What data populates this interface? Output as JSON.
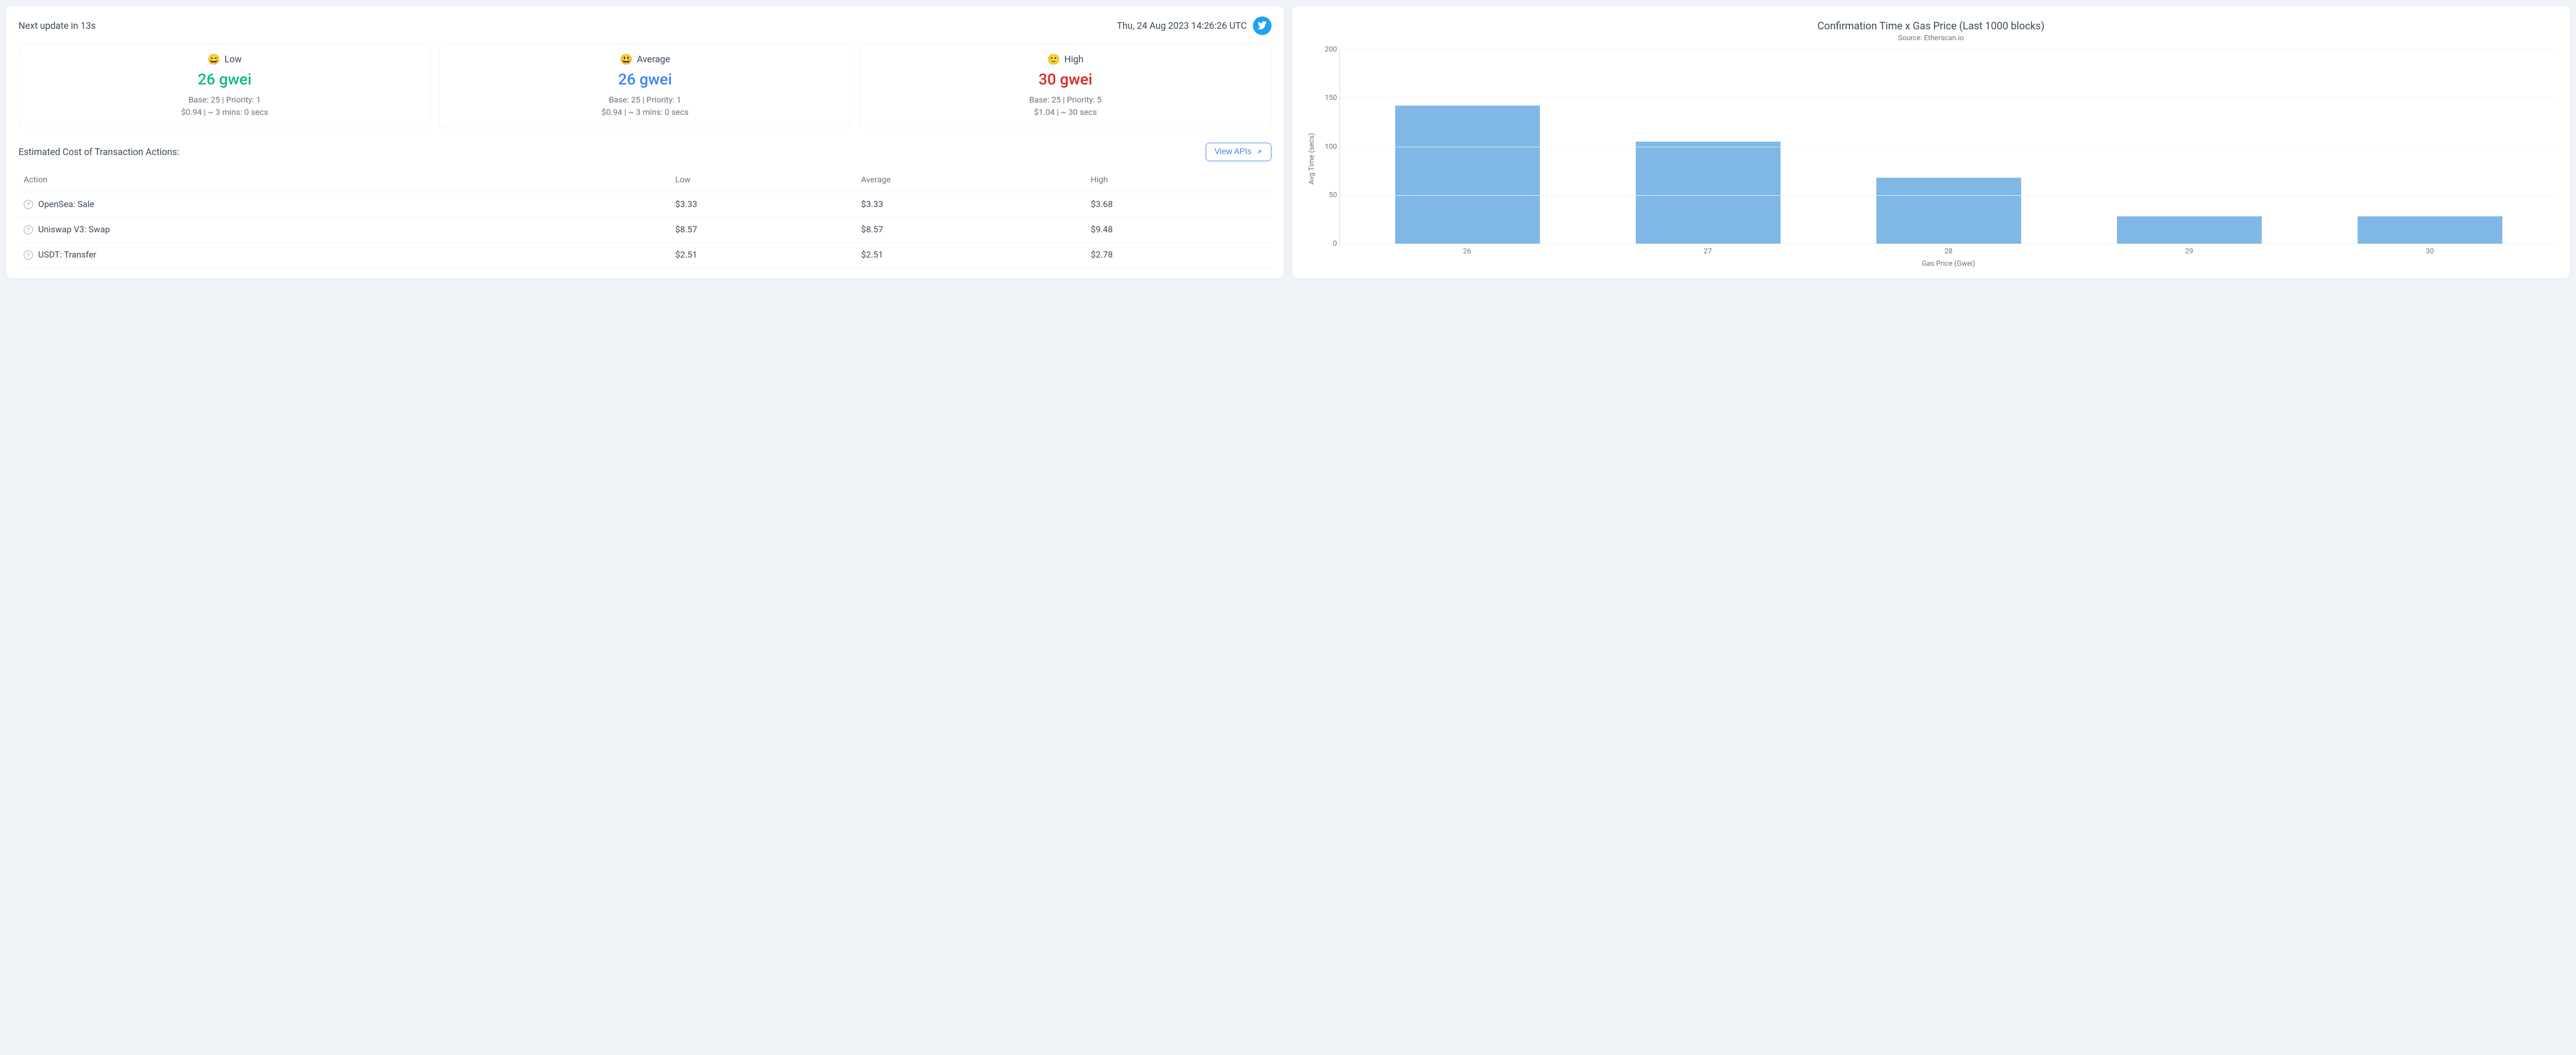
{
  "header": {
    "next_update": "Next update in 13s",
    "timestamp": "Thu, 24 Aug 2023 14:26:26 UTC"
  },
  "gas": {
    "low": {
      "label": "Low",
      "emoji": "😄",
      "value": "26 gwei",
      "base_priority": "Base: 25 | Priority: 1",
      "cost_time": "$0.94 | ~ 3 mins: 0 secs"
    },
    "avg": {
      "label": "Average",
      "emoji": "😃",
      "value": "26 gwei",
      "base_priority": "Base: 25 | Priority: 1",
      "cost_time": "$0.94 | ~ 3 mins: 0 secs"
    },
    "high": {
      "label": "High",
      "emoji": "🙂",
      "value": "30 gwei",
      "base_priority": "Base: 25 | Priority: 5",
      "cost_time": "$1.04 | ~ 30 secs"
    }
  },
  "table": {
    "title": "Estimated Cost of Transaction Actions:",
    "view_apis": "View APIs",
    "headers": {
      "action": "Action",
      "low": "Low",
      "avg": "Average",
      "high": "High"
    },
    "rows": [
      {
        "action": "OpenSea: Sale",
        "low": "$3.33",
        "avg": "$3.33",
        "high": "$3.68"
      },
      {
        "action": "Uniswap V3: Swap",
        "low": "$8.57",
        "avg": "$8.57",
        "high": "$9.48"
      },
      {
        "action": "USDT: Transfer",
        "low": "$2.51",
        "avg": "$2.51",
        "high": "$2.78"
      }
    ]
  },
  "chart_data": {
    "type": "bar",
    "title": "Confirmation Time x Gas Price (Last 1000 blocks)",
    "subtitle": "Source: Etherscan.io",
    "xlabel": "Gas Price (Gwei)",
    "ylabel": "Avg Time (secs)",
    "ylim": [
      0,
      200
    ],
    "yticks": [
      0,
      50,
      100,
      150,
      200
    ],
    "categories": [
      "26",
      "27",
      "28",
      "29",
      "30"
    ],
    "values": [
      142,
      105,
      68,
      28,
      28
    ]
  }
}
